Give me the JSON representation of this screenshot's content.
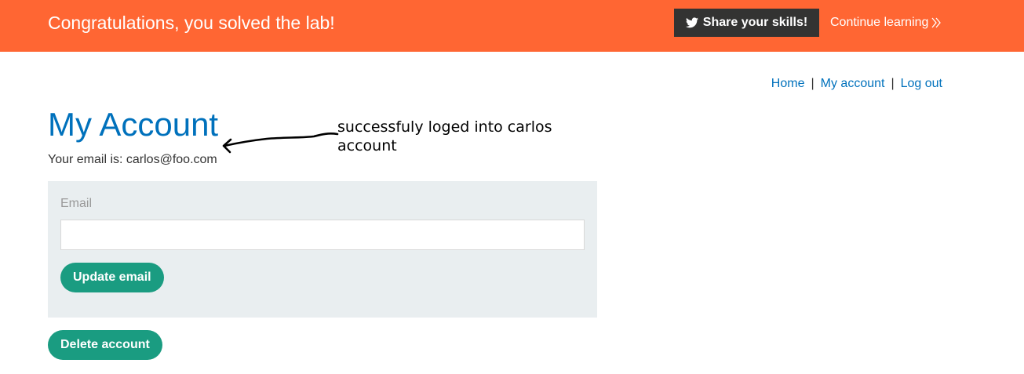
{
  "banner": {
    "title": "Congratulations, you solved the lab!",
    "share_label": "Share your skills!",
    "continue_label": "Continue learning",
    "background": "#ff6633"
  },
  "nav": {
    "home": "Home",
    "my_account": "My account",
    "log_out": "Log out",
    "separator": "|"
  },
  "page": {
    "title": "My Account",
    "email_line": "Your email is: carlos@foo.com"
  },
  "annotation": {
    "text": "successfuly loged into carlos account"
  },
  "form": {
    "email_label": "Email",
    "email_value": "",
    "update_label": "Update email"
  },
  "delete_label": "Delete account",
  "colors": {
    "accent": "#0071bc",
    "button": "#1a9c81",
    "panel": "#e9eef0"
  },
  "icons": {
    "share": "twitter-icon",
    "continue": "double-chevron-right-icon"
  }
}
